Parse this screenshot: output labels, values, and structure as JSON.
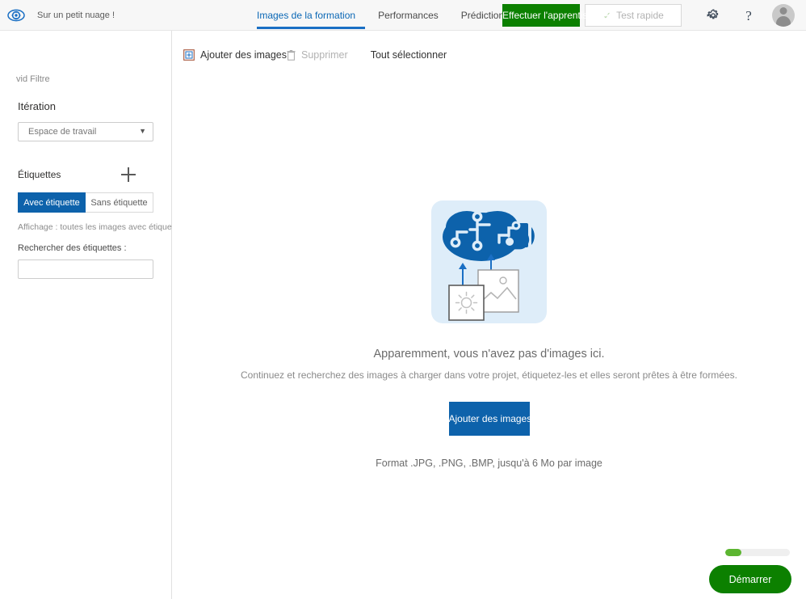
{
  "app": {
    "logo_icon": "eye-gear-icon",
    "project_title": "Sur un petit nuage !"
  },
  "nav": {
    "tabs": [
      {
        "label": "Images de la formation",
        "active": true
      },
      {
        "label": "Performances",
        "active": false
      },
      {
        "label": "Prédictions",
        "active": false
      }
    ]
  },
  "topbar_actions": {
    "train_label": "Effectuer l'apprentissage",
    "quick_test_label": "Test rapide",
    "quick_test_icon": "check-icon",
    "settings_icon": "gear-icon",
    "help_icon": "question-mark-icon",
    "help_glyph": "?",
    "avatar_icon": "user-avatar"
  },
  "sidebar": {
    "filter_label": "vid Filtre",
    "iteration_title": "Itération",
    "workspace_select": {
      "value": "Espace de travail",
      "options": [
        "Espace de travail"
      ],
      "caret_icon": "chevron-down-icon"
    },
    "tags": {
      "heading": "Étiquettes",
      "add_icon": "plus-icon",
      "segments": [
        {
          "label": "Avec étiquette",
          "active": true
        },
        {
          "label": "Sans étiquette",
          "active": false
        }
      ],
      "display_note": "Affichage : toutes les images avec étiquette",
      "search_label": "Rechercher des étiquettes :",
      "search_value": "",
      "search_placeholder": ""
    }
  },
  "toolbar": {
    "add_images_icon": "add-image-icon",
    "add_images_label": "Ajouter des images",
    "delete_icon": "trash-icon",
    "delete_label": "Supprimer",
    "select_all_label": "Tout sélectionner"
  },
  "empty_state": {
    "illustration_icon": "brain-cloud-upload-illustration",
    "title": "Apparemment, vous n'avez pas d'images ici.",
    "subtitle": "Continuez et recherchez des images à charger dans votre projet, étiquetez-les et elles seront prêtes à être formées.",
    "add_button_label": "Ajouter des images",
    "format_note": "Format .JPG, .PNG, .BMP, jusqu'à 6 Mo par image"
  },
  "bottom_right": {
    "progress_percent": 25,
    "start_button_label": "Démarrer"
  },
  "colors": {
    "accent_blue": "#0d62ab",
    "tab_blue": "#1a6fc4",
    "train_green": "#0c8000",
    "progress_green": "#5cb531",
    "illustration_bg": "#deedf9"
  }
}
